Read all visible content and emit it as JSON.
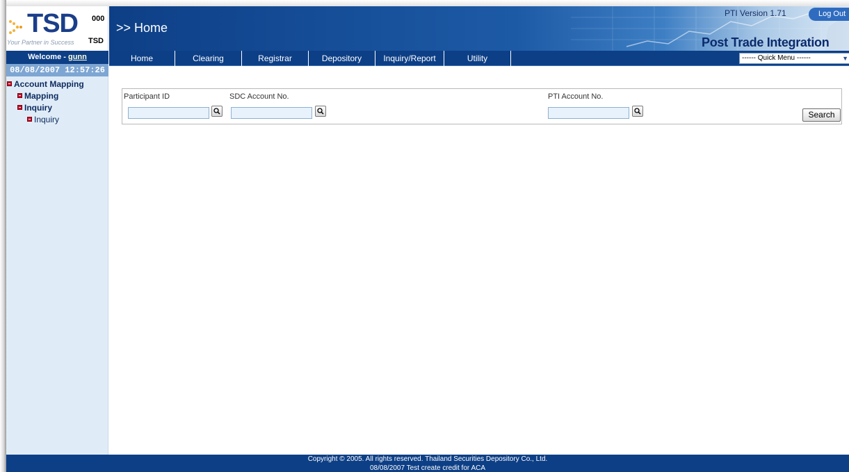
{
  "header": {
    "logo_text": "TSD",
    "logo_tagline": "Your Partner in Success",
    "org_code": "000",
    "org_name": "TSD",
    "page_title": ">> Home",
    "version": "PTI Version 1.71",
    "logout_label": "Log Out",
    "product_name": "Post Trade Integration"
  },
  "welcome": {
    "prefix": "Welcome - ",
    "user": "gunn"
  },
  "nav": {
    "items": [
      "Home",
      "Clearing",
      "Registrar",
      "Depository",
      "Inquiry/Report",
      "Utility"
    ],
    "quick_menu": "------ Quick Menu ------"
  },
  "sidebar": {
    "datetime": "08/08/2007 12:57:26",
    "tree": [
      {
        "label": "Account Mapping"
      },
      {
        "label": "Mapping"
      },
      {
        "label": "Inquiry"
      },
      {
        "label": "Inquiry"
      }
    ]
  },
  "search": {
    "participant_label": "Participant ID",
    "participant_value": "",
    "sdc_label": "SDC Account No.",
    "sdc_value": "",
    "pti_label": "PTI Account No.",
    "pti_value": "",
    "search_button": "Search"
  },
  "footer": {
    "copyright": "Copyright © 2005. All rights reserved. Thailand Securities Depository Co., Ltd.",
    "note": "08/08/2007 Test create credit for ACA"
  },
  "colors": {
    "nav_bg": "#0d3f86",
    "sidebar_bg": "#dfecf7",
    "datetime_bg": "#7ea6d3",
    "input_bg": "#e7f2fc"
  }
}
